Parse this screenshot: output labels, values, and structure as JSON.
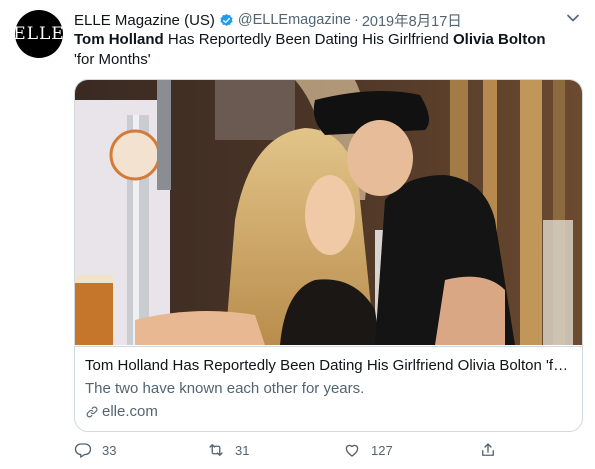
{
  "author": {
    "avatar_text": "ELLE",
    "name": "ELLE Magazine (US)",
    "handle": "@ELLEmagazine",
    "separator": "·",
    "date": "2019年8月17日"
  },
  "tweet": {
    "text_parts": {
      "p1": "Tom Holland",
      "p2": " Has Reportedly Been Dating His Girlfriend ",
      "p3": "Olivia Bolton",
      "p4": " 'for Months'"
    }
  },
  "card": {
    "title": "Tom Holland Has Reportedly Been Dating His Girlfriend Olivia Bolton 'for Months'",
    "description": "The two have known each other for years.",
    "domain": "elle.com"
  },
  "actions": {
    "reply_count": "33",
    "retweet_count": "31",
    "like_count": "127"
  },
  "colors": {
    "verified_blue": "#1d9bf0",
    "muted_text": "#536471"
  },
  "icons": [
    "verified-icon",
    "caret-down-icon",
    "link-icon",
    "reply-icon",
    "retweet-icon",
    "like-icon",
    "share-icon"
  ]
}
